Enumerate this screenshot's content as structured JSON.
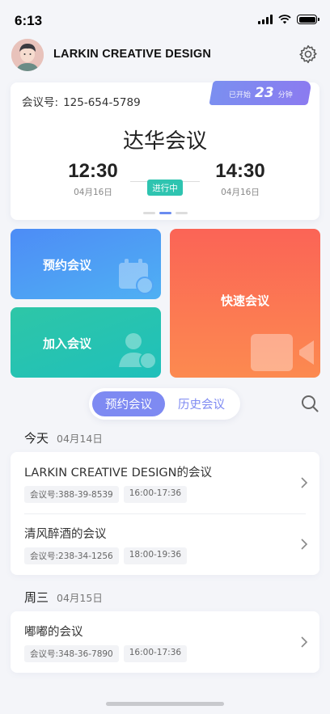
{
  "status_bar": {
    "time": "6:13"
  },
  "header": {
    "title": "LARKIN CREATIVE DESIGN",
    "avatar_icon": "user-avatar",
    "settings_icon": "gear-icon"
  },
  "current_meeting": {
    "id_label": "会议号:",
    "id": "125-654-5789",
    "elapsed_prefix": "已开始",
    "elapsed_value": "23",
    "elapsed_suffix": "分钟",
    "title": "达华会议",
    "start_time": "12:30",
    "start_date": "04月16日",
    "status": "进行中",
    "end_time": "14:30",
    "end_date": "04月16日"
  },
  "actions": {
    "book": {
      "label": "预约会议",
      "icon": "calendar-clock-icon"
    },
    "join": {
      "label": "加入会议",
      "icon": "user-add-icon"
    },
    "quick": {
      "label": "快速会议",
      "icon": "video-camera-icon"
    }
  },
  "tabs": {
    "active": "预约会议",
    "inactive": "历史会议"
  },
  "days": [
    {
      "weekday": "今天",
      "date": "04月14日",
      "meetings": [
        {
          "title": "LARKIN CREATIVE DESIGN的会议",
          "id_tag": "会议号:388-39-8539",
          "time_tag": "16:00-17:36"
        },
        {
          "title": "清风醉酒的会议",
          "id_tag": "会议号:238-34-1256",
          "time_tag": "18:00-19:36"
        }
      ]
    },
    {
      "weekday": "周三",
      "date": "04月15日",
      "meetings": [
        {
          "title": "嘟嘟的会议",
          "id_tag": "会议号:348-36-7890",
          "time_tag": "16:00-17:36"
        }
      ]
    }
  ],
  "colors": {
    "accent": "#7e8af2",
    "teal": "#2ec4b0",
    "blue": "#4d8cf6",
    "orange": "#fb6456"
  }
}
